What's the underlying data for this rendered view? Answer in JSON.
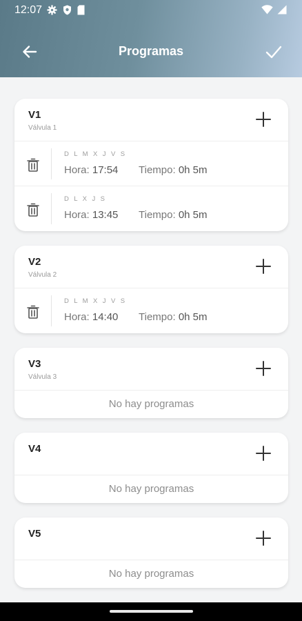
{
  "status": {
    "time": "12:07"
  },
  "nav": {
    "title": "Programas"
  },
  "valves": [
    {
      "title": "V1",
      "subtitle": "Válvula 1",
      "programs": [
        {
          "days": "D L M X J V S",
          "hora_label": "Hora:",
          "hora": "17:54",
          "tiempo_label": "Tiempo:",
          "tiempo": "0h 5m"
        },
        {
          "days": "D L X J S",
          "hora_label": "Hora:",
          "hora": "13:45",
          "tiempo_label": "Tiempo:",
          "tiempo": "0h 5m"
        }
      ]
    },
    {
      "title": "V2",
      "subtitle": "Válvula 2",
      "programs": [
        {
          "days": "D L M X J V S",
          "hora_label": "Hora:",
          "hora": "14:40",
          "tiempo_label": "Tiempo:",
          "tiempo": "0h 5m"
        }
      ]
    },
    {
      "title": "V3",
      "subtitle": "Válvula 3",
      "empty": "No hay programas"
    },
    {
      "title": "V4",
      "subtitle": "",
      "empty": "No hay programas"
    },
    {
      "title": "V5",
      "subtitle": "",
      "empty": "No hay programas"
    }
  ],
  "colors": {
    "header_start": "#5a7a88",
    "header_end": "#b7cbe0"
  },
  "icons": [
    "settings-icon",
    "shield-icon",
    "sd-card-icon",
    "wifi-icon",
    "signal-icon",
    "back-arrow-icon",
    "check-icon",
    "add-icon",
    "trash-icon"
  ]
}
